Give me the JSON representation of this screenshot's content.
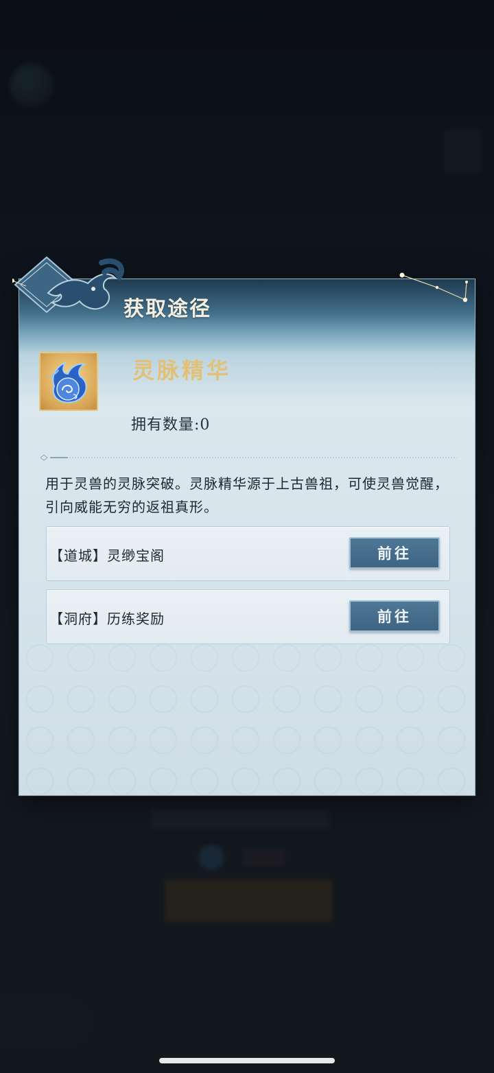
{
  "dialog": {
    "title": "获取途径",
    "item": {
      "name": "灵脉精华",
      "owned_label": "拥有数量:0",
      "icon": "spirit-essence-icon",
      "description": "用于灵兽的灵脉突破。灵脉精华源于上古兽祖，可使灵兽觉醒，引向威能无穷的返祖真形。"
    },
    "sources": [
      {
        "label": "【道城】灵缈宝阁",
        "button": "前往"
      },
      {
        "label": "【洞府】历练奖励",
        "button": "前往"
      }
    ]
  },
  "colors": {
    "title": "#f4efe0",
    "item_name": "#e2c177",
    "button_bg": "#4a7191",
    "panel_bg": "#d7e4ec"
  }
}
